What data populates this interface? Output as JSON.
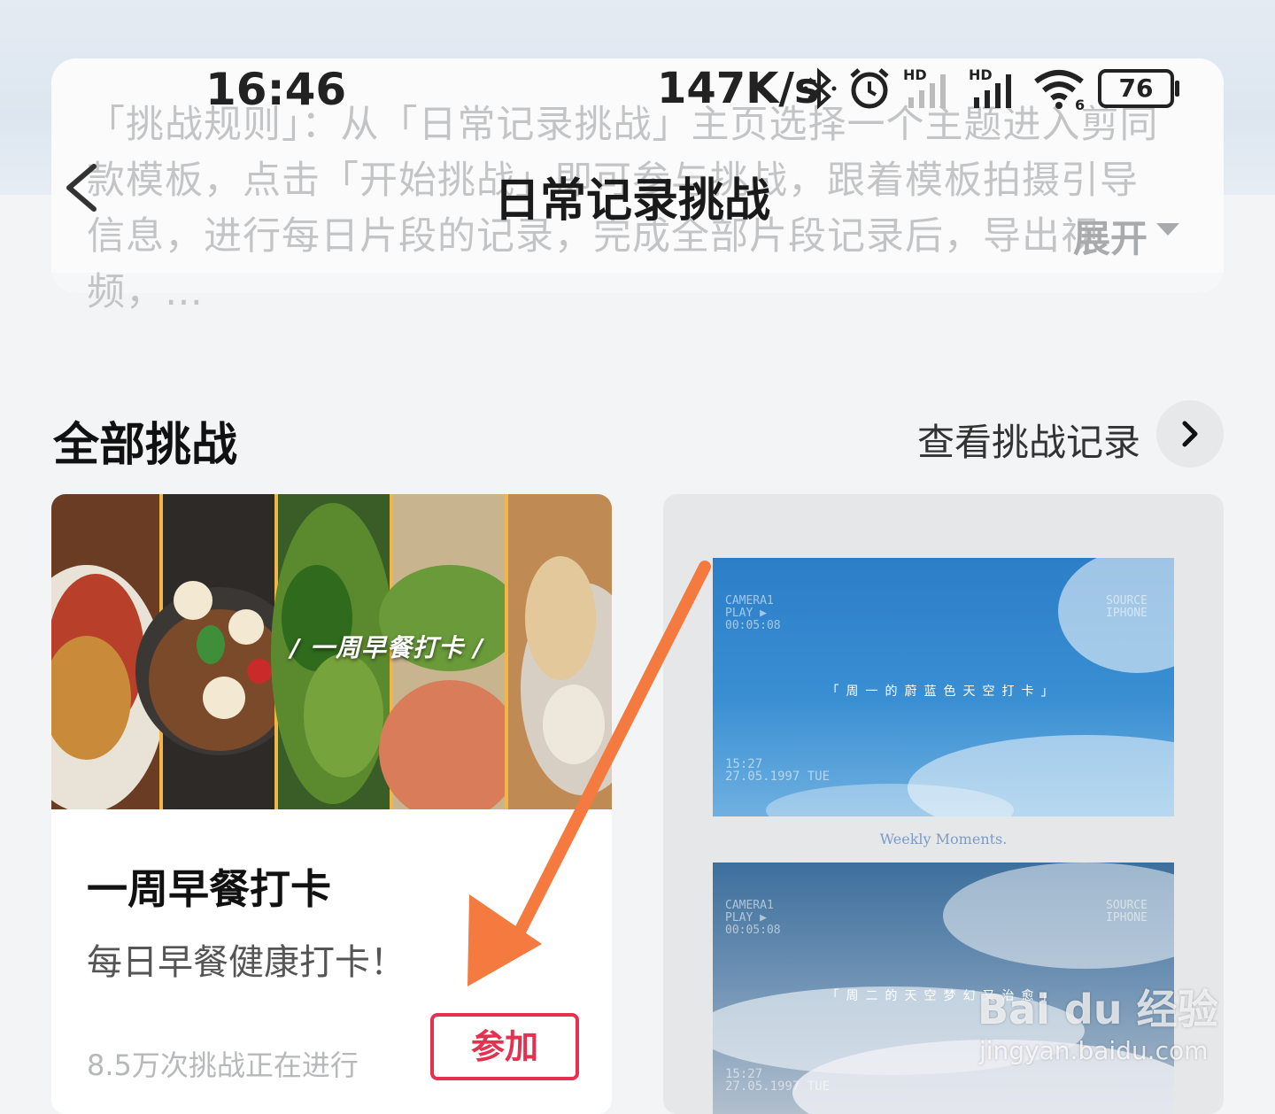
{
  "status_bar": {
    "time": "16:46",
    "net_speed": "147K/s",
    "battery": "76",
    "signal_badge_1": "HD",
    "signal_badge_2": "HD",
    "wifi_badge": "6"
  },
  "header": {
    "title": "日常记录挑战",
    "rules_text": "「挑战规则」：从「日常记录挑战」主页选择一个主题进入剪同款模板，点击「开始挑战」即可参与挑战，跟着模板拍摄引导信息，进行每日片段的记录，完成全部片段记录后，导出视频，…",
    "expand_label": "展开"
  },
  "section": {
    "title": "全部挑战",
    "record_link": "查看挑战记录"
  },
  "card_left": {
    "banner_text": "/ 一周早餐打卡 /",
    "title": "一周早餐打卡",
    "description": "每日早餐健康打卡！",
    "count": "8.5万次挑战正在进行",
    "join_label": "参加"
  },
  "card_right": {
    "cam_left_1": "CAMERA1\nPLAY ▶\n00:05:08",
    "cam_right_1": "SOURCE\nIPHONE",
    "caption_1": "「周一的蔚蓝色天空打卡」",
    "date_1": "15:27\n27.05.1997 TUE",
    "weekly": "Weekly Moments.",
    "cam_left_2": "CAMERA1\nPLAY ▶\n00:05:08",
    "cam_right_2": "SOURCE\nIPHONE",
    "caption_2": "「周二的天空梦幻又治愈」",
    "date_2": "15:27\n27.05.1997 TUE"
  },
  "watermark": {
    "brand": "Bai du 经验",
    "url": "jingyan.baidu.com"
  },
  "colors": {
    "accent": "#e6304f",
    "annotation_arrow": "#f47a3f"
  }
}
